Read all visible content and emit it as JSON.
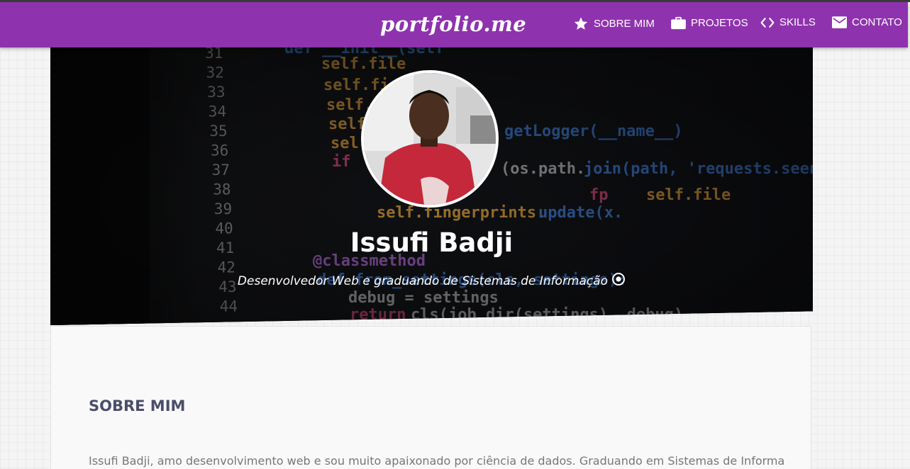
{
  "navbar": {
    "brand": "portfolio.me",
    "items": [
      {
        "label": "SOBRE MIM",
        "icon": "star-icon"
      },
      {
        "label": "PROJETOS",
        "icon": "briefcase-icon"
      },
      {
        "label": "SKILLS",
        "icon": "code-icon"
      },
      {
        "label": "CONTATO",
        "icon": "envelope-icon"
      }
    ]
  },
  "hero": {
    "name": "Issufi Badji",
    "subtitle": "Desenvolvedor Web e graduando de Sistemas de Informação",
    "subtitle_icon": "target-icon",
    "code_line_numbers": [
      "31",
      "32",
      "33",
      "34",
      "35",
      "36",
      "37",
      "38",
      "39",
      "40",
      "41",
      "42",
      "43",
      "44"
    ],
    "code_fragments": [
      "self.file",
      "self.fi",
      "self.",
      "self.",
      "self.fingerprints.update(s.",
      "if",
      "@classmethod",
      "def from_settings(cls, settings):",
      "debug = settings",
      "return cls(job_dir(settings), debug)",
      "getLogger(__name__)",
      "(os.path.join(path, 'requests.seen')"
    ]
  },
  "about": {
    "heading": "SOBRE MIM",
    "text": "Issufi Badji, amo desenvolvimento web e sou muito apaixonado por ciência de dados. Graduando em Sistemas de Informação"
  },
  "colors": {
    "navbar": "#8e33ad",
    "heading": "#4a4e69",
    "body_text": "#777777"
  }
}
